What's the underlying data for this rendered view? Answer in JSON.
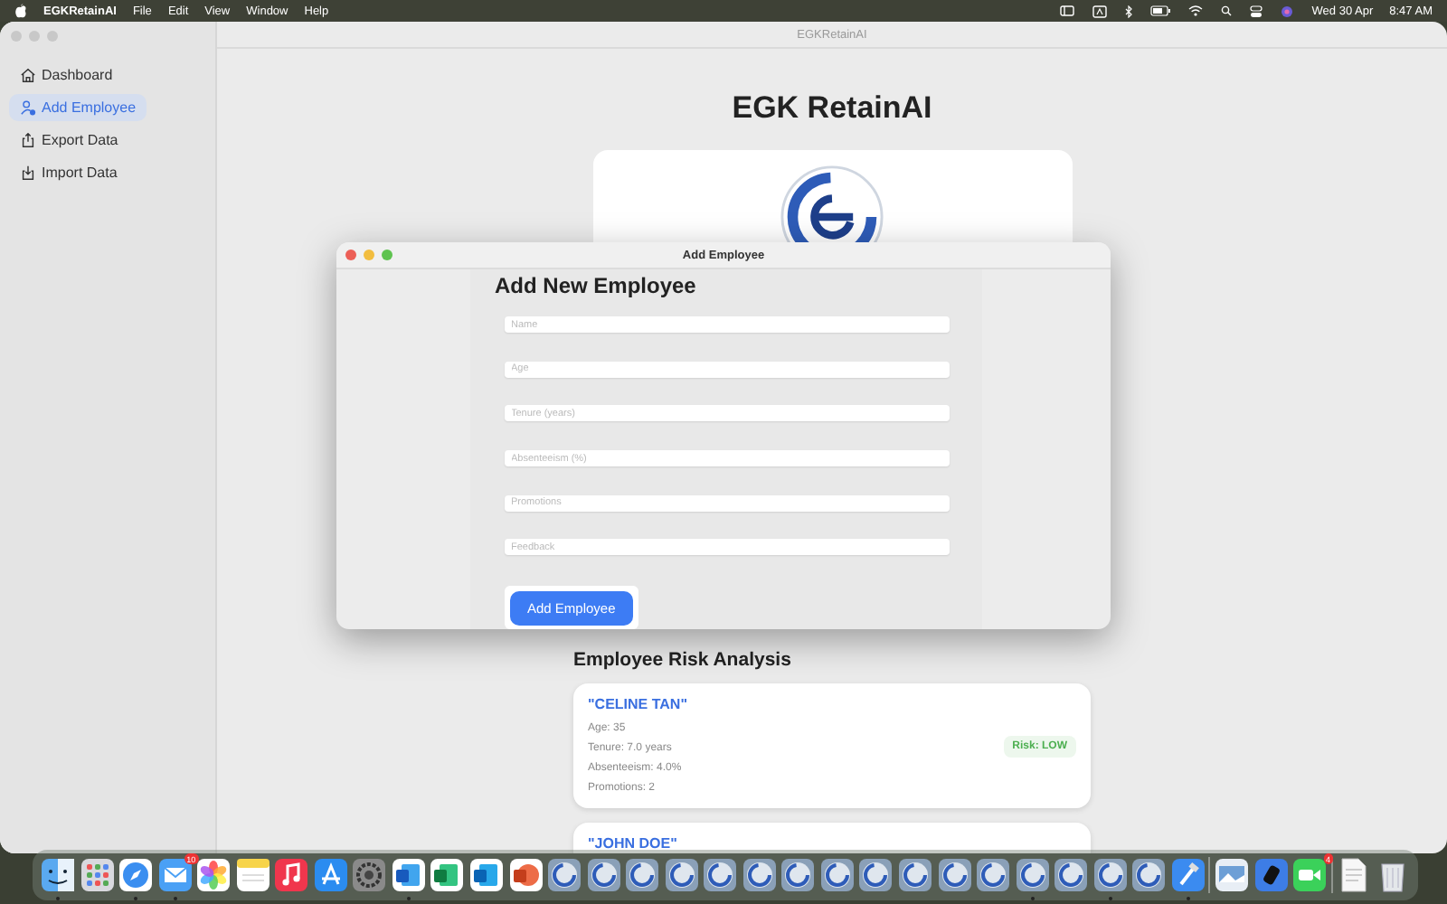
{
  "menubar": {
    "app": "EGKRetainAI",
    "menus": [
      "File",
      "Edit",
      "View",
      "Window",
      "Help"
    ],
    "date": "Wed 30 Apr",
    "time": "8:47 AM"
  },
  "window": {
    "title": "EGKRetainAI"
  },
  "sidebar": {
    "items": [
      {
        "label": "Dashboard",
        "kind": "house",
        "selected": false
      },
      {
        "label": "Add Employee",
        "kind": "person",
        "selected": true
      },
      {
        "label": "Export Data",
        "kind": "export",
        "selected": false
      },
      {
        "label": "Import Data",
        "kind": "import",
        "selected": false
      }
    ]
  },
  "main": {
    "title": "EGK RetainAI",
    "section_title": "Employee Risk Analysis",
    "employees": [
      {
        "name": "\"CELINE TAN\"",
        "details": [
          "Age: 35",
          "Tenure: 7.0 years",
          "Absenteeism: 4.0%",
          "Promotions: 2"
        ],
        "risk": {
          "label": "Risk: LOW",
          "color": "#4caf50"
        }
      },
      {
        "name": "\"JOHN DOE\""
      }
    ]
  },
  "dialog": {
    "title": "Add Employee",
    "heading": "Add New Employee",
    "fields": [
      {
        "placeholder": "Name"
      },
      {
        "placeholder": "Age"
      },
      {
        "placeholder": "Tenure (years)"
      },
      {
        "placeholder": "Absenteeism (%)"
      },
      {
        "placeholder": "Promotions"
      },
      {
        "placeholder": "Feedback"
      }
    ],
    "button": "Add Employee"
  },
  "dock": [
    {
      "kind": "finder",
      "running": true
    },
    {
      "kind": "launchpad",
      "running": false
    },
    {
      "kind": "safari",
      "running": true
    },
    {
      "kind": "mail",
      "running": true,
      "badge": "10"
    },
    {
      "kind": "photos",
      "running": false
    },
    {
      "kind": "notes",
      "running": false
    },
    {
      "kind": "music",
      "running": false
    },
    {
      "kind": "appstore",
      "running": false
    },
    {
      "kind": "settings",
      "running": false
    },
    {
      "kind": "word",
      "running": true
    },
    {
      "kind": "excel",
      "running": false
    },
    {
      "kind": "outlook",
      "running": false
    },
    {
      "kind": "powerpoint",
      "running": false
    },
    {
      "kind": "logo",
      "running": false
    },
    {
      "kind": "logo",
      "running": false
    },
    {
      "kind": "logo",
      "running": false
    },
    {
      "kind": "logo",
      "running": false
    },
    {
      "kind": "logo",
      "running": false
    },
    {
      "kind": "logo",
      "running": false
    },
    {
      "kind": "logo",
      "running": false
    },
    {
      "kind": "logo",
      "running": false
    },
    {
      "kind": "logo",
      "running": false
    },
    {
      "kind": "logo",
      "running": false
    },
    {
      "kind": "logo",
      "running": false
    },
    {
      "kind": "logo",
      "running": false
    },
    {
      "kind": "logo",
      "running": true
    },
    {
      "kind": "logo",
      "running": false
    },
    {
      "kind": "logo",
      "running": true
    },
    {
      "kind": "logo",
      "running": false
    },
    {
      "kind": "xcode",
      "running": true
    },
    {
      "kind": "separator"
    },
    {
      "kind": "preview",
      "running": false
    },
    {
      "kind": "app",
      "running": false
    },
    {
      "kind": "facetime",
      "running": false,
      "badge": "4"
    },
    {
      "kind": "separator"
    },
    {
      "kind": "document",
      "running": false
    },
    {
      "kind": "trash",
      "running": false
    }
  ]
}
